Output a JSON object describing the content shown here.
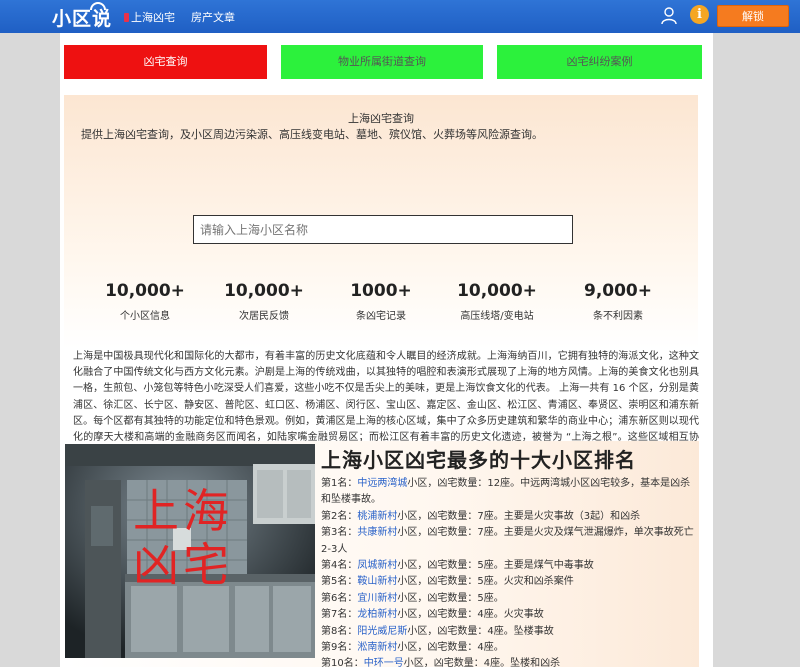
{
  "header": {
    "logo": "小区说",
    "nav": [
      {
        "label": "上海凶宅"
      },
      {
        "label": "房产文章"
      }
    ],
    "unlock_label": "解锁",
    "info_label": "i"
  },
  "buttons": {
    "b1": "凶宅查询",
    "b2": "物业所属街道查询",
    "b3": "凶宅纠纷案例"
  },
  "hero": {
    "title": "上海凶宅查询",
    "desc": "提供上海凶宅查询，及小区周边污染源、高压线变电站、墓地、殡仪馆、火葬场等风险源查询。",
    "search_placeholder": "请输入上海小区名称",
    "stats": [
      {
        "num": "10,000+",
        "label": "个小区信息"
      },
      {
        "num": "10,000+",
        "label": "次居民反馈"
      },
      {
        "num": "1000+",
        "label": "条凶宅记录"
      },
      {
        "num": "10,000+",
        "label": "高压线塔/变电站"
      },
      {
        "num": "9,000+",
        "label": "条不利因素"
      }
    ],
    "paragraph": "上海是中国极具现代化和国际化的大都市，有着丰富的历史文化底蕴和令人瞩目的经济成就。上海海纳百川，它拥有独特的海派文化，这种文化融合了中国传统文化与西方文化元素。沪剧是上海的传统戏曲，以其独特的唱腔和表演形式展现了上海的地方风情。上海的美食文化也别具一格，生煎包、小笼包等特色小吃深受人们喜爱，这些小吃不仅是舌尖上的美味，更是上海饮食文化的代表。 上海一共有 16 个区，分别是黄浦区、徐汇区、长宁区、静安区、普陀区、虹口区、杨浦区、闵行区、宝山区、嘉定区、金山区、松江区、青浦区、奉贤区、崇明区和浦东新区。每个区都有其独特的功能定位和特色景观。例如，黄浦区是上海的核心区域，集中了众多历史建筑和繁华的商业中心；浦东新区则以现代化的摩天大楼和高端的金融商务区而闻名，如陆家嘴金融贸易区；而松江区有着丰富的历史文化遗迹，被誉为 “上海之根”。这些区域相互协作，共同构成了上海这座充满活力的城市。"
  },
  "ranking": {
    "title": "上海小区凶宅最多的十大小区排名",
    "photo_caption": "上海凶宅",
    "items": [
      {
        "prefix": "第1名：",
        "name": "中远两湾城",
        "rest": "小区，凶宅数量：12座。中远两湾城小区凶宅较多，基本是凶杀和坠楼事故。"
      },
      {
        "prefix": "第2名：",
        "name": "桃浦新村",
        "rest": "小区，凶宅数量：7座。主要是火灾事故（3起）和凶杀"
      },
      {
        "prefix": "第3名：",
        "name": "共康新村",
        "rest": "小区，凶宅数量：7座。主要是火灾及煤气泄漏爆炸，单次事故死亡2-3人"
      },
      {
        "prefix": "第4名：",
        "name": "凤城新村",
        "rest": "小区，凶宅数量：5座。主要是煤气中毒事故"
      },
      {
        "prefix": "第5名：",
        "name": "鞍山新村",
        "rest": "小区，凶宅数量：5座。火灾和凶杀案件"
      },
      {
        "prefix": "第6名：",
        "name": "宜川新村",
        "rest": "小区，凶宅数量：5座。"
      },
      {
        "prefix": "第7名：",
        "name": "龙柏新村",
        "rest": "小区，凶宅数量：4座。火灾事故"
      },
      {
        "prefix": "第8名：",
        "name": "阳光威尼斯",
        "rest": "小区，凶宅数量：4座。坠楼事故"
      },
      {
        "prefix": "第9名：",
        "name": "淞南新村",
        "rest": "小区，凶宅数量：4座。"
      },
      {
        "prefix": "第10名：",
        "name": "中环一号",
        "rest": "小区，凶宅数量：4座。坠楼和凶杀"
      }
    ]
  },
  "colors": {
    "header_blue": "#2f74d6",
    "primary_red": "#ee1111",
    "green": "#2cf13c",
    "unlock_orange": "#f57b1f",
    "link_blue": "#2a62c9"
  }
}
